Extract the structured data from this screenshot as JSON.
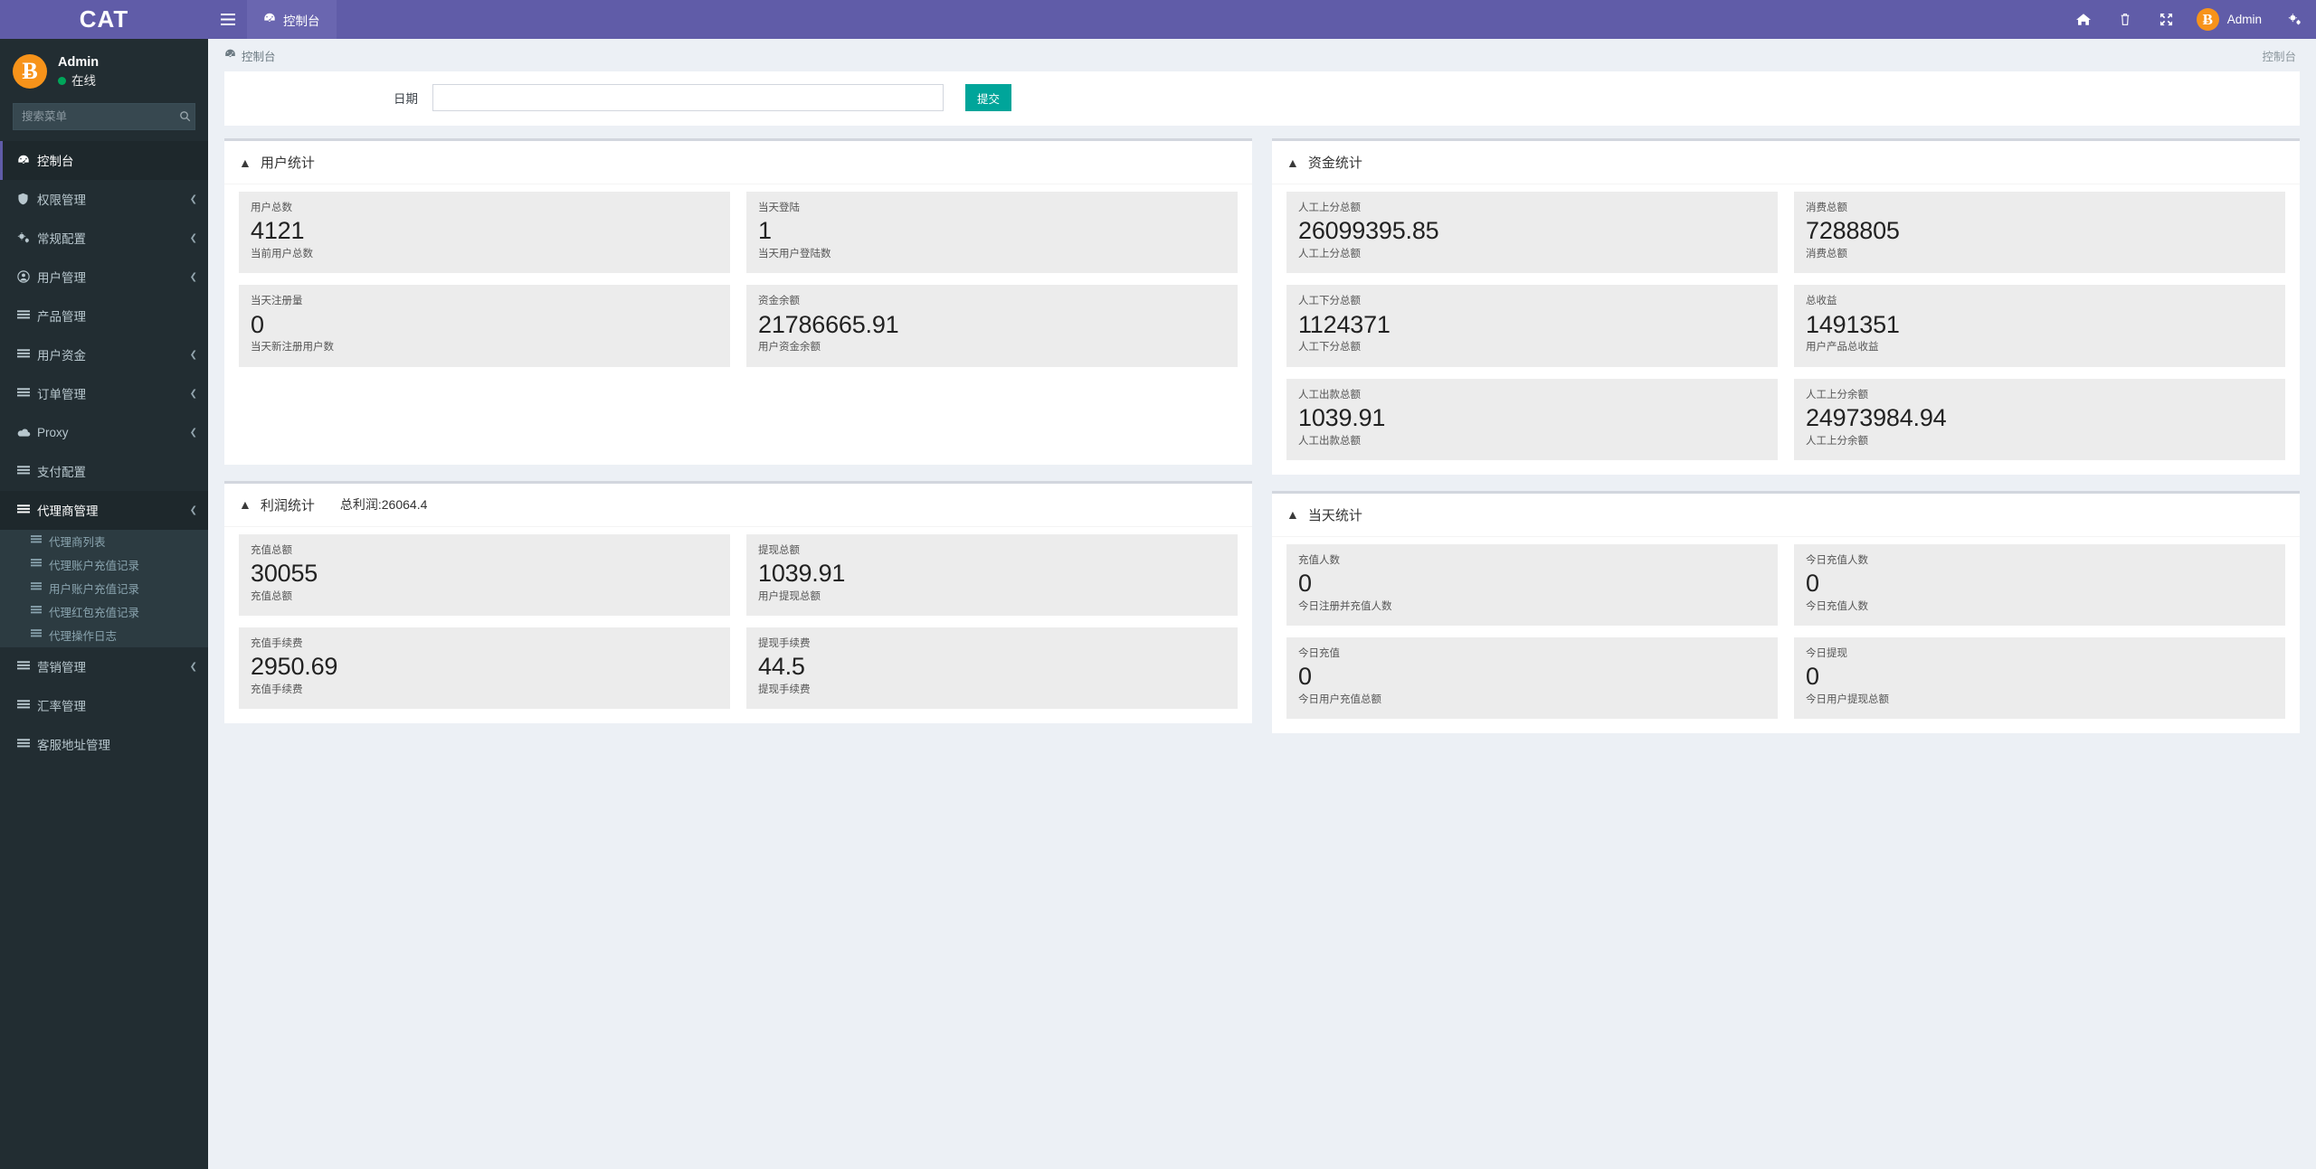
{
  "brand": {
    "title": "CAT"
  },
  "sidebar": {
    "user": {
      "name": "Admin",
      "status": "在线",
      "avatar_glyph": "Ƀ"
    },
    "search": {
      "placeholder": "搜索菜单",
      "value": ""
    },
    "items": [
      {
        "label": "控制台",
        "icon": "dashboard-icon",
        "active": true,
        "has_arrow": false
      },
      {
        "label": "权限管理",
        "icon": "shield-icon",
        "active": false,
        "has_arrow": true
      },
      {
        "label": "常规配置",
        "icon": "gears-icon",
        "active": false,
        "has_arrow": true
      },
      {
        "label": "用户管理",
        "icon": "user-circle-icon",
        "active": false,
        "has_arrow": true
      },
      {
        "label": "产品管理",
        "icon": "list-icon",
        "active": false,
        "has_arrow": false
      },
      {
        "label": "用户资金",
        "icon": "list-icon",
        "active": false,
        "has_arrow": true
      },
      {
        "label": "订单管理",
        "icon": "list-icon",
        "active": false,
        "has_arrow": true
      },
      {
        "label": "Proxy",
        "icon": "cloud-icon",
        "active": false,
        "has_arrow": true
      },
      {
        "label": "支付配置",
        "icon": "list-icon",
        "active": false,
        "has_arrow": false
      },
      {
        "label": "代理商管理",
        "icon": "list-icon",
        "active": false,
        "has_arrow": true,
        "submenu": [
          {
            "label": "代理商列表",
            "icon": "list-icon"
          },
          {
            "label": "代理账户充值记录",
            "icon": "list-icon"
          },
          {
            "label": "用户账户充值记录",
            "icon": "list-icon"
          },
          {
            "label": "代理红包充值记录",
            "icon": "list-icon"
          },
          {
            "label": "代理操作日志",
            "icon": "list-icon"
          }
        ]
      },
      {
        "label": "营销管理",
        "icon": "list-icon",
        "active": false,
        "has_arrow": true
      },
      {
        "label": "汇率管理",
        "icon": "list-icon",
        "active": false,
        "has_arrow": false
      },
      {
        "label": "客服地址管理",
        "icon": "list-icon",
        "active": false,
        "has_arrow": false
      }
    ]
  },
  "topbar": {
    "toggle_icon": "hamburger-icon",
    "tab_label": "控制台",
    "tab_icon": "dashboard-icon",
    "icons": [
      "home-icon",
      "trash-icon",
      "fullscreen-icon"
    ],
    "user_label": "Admin",
    "user_avatar_glyph": "Ƀ",
    "settings_icon": "gears-icon"
  },
  "content_header": {
    "breadcrumb": "控制台",
    "breadcrumb_icon": "dashboard-icon",
    "right_label": "控制台"
  },
  "filter": {
    "label": "日期",
    "value": "",
    "placeholder": "",
    "submit_label": "提交"
  },
  "panels": {
    "user_stats": {
      "title": "用户统计",
      "cards": [
        {
          "top": "用户总数",
          "value": "4121",
          "bottom": "当前用户总数"
        },
        {
          "top": "当天登陆",
          "value": "1",
          "bottom": "当天用户登陆数"
        },
        {
          "top": "当天注册量",
          "value": "0",
          "bottom": "当天新注册用户数"
        },
        {
          "top": "资金余额",
          "value": "21786665.91",
          "bottom": "用户资金余额"
        }
      ]
    },
    "fund_stats": {
      "title": "资金统计",
      "cards": [
        {
          "top": "人工上分总额",
          "value": "26099395.85",
          "bottom": "人工上分总额"
        },
        {
          "top": "消费总额",
          "value": "7288805",
          "bottom": "消费总额"
        },
        {
          "top": "人工下分总额",
          "value": "1124371",
          "bottom": "人工下分总额"
        },
        {
          "top": "总收益",
          "value": "1491351",
          "bottom": "用户产品总收益"
        },
        {
          "top": "人工出款总额",
          "value": "1039.91",
          "bottom": "人工出款总额"
        },
        {
          "top": "人工上分余额",
          "value": "24973984.94",
          "bottom": "人工上分余额"
        }
      ]
    },
    "profit_stats": {
      "title": "利润统计",
      "extra": "总利润:26064.4",
      "cards": [
        {
          "top": "充值总额",
          "value": "30055",
          "bottom": "充值总额"
        },
        {
          "top": "提现总额",
          "value": "1039.91",
          "bottom": "用户提现总额"
        },
        {
          "top": "充值手续费",
          "value": "2950.69",
          "bottom": "充值手续费"
        },
        {
          "top": "提现手续费",
          "value": "44.5",
          "bottom": "提现手续费"
        }
      ]
    },
    "today_stats": {
      "title": "当天统计",
      "cards": [
        {
          "top": "充值人数",
          "value": "0",
          "bottom": "今日注册并充值人数"
        },
        {
          "top": "今日充值人数",
          "value": "0",
          "bottom": "今日充值人数"
        },
        {
          "top": "今日充值",
          "value": "0",
          "bottom": "今日用户充值总额"
        },
        {
          "top": "今日提现",
          "value": "0",
          "bottom": "今日用户提现总额"
        }
      ]
    }
  },
  "colors": {
    "brand_purple": "#605ca8",
    "sidebar_dark": "#222d32",
    "submenu_dark": "#2c3b41",
    "accent_teal": "#00a59a",
    "bitcoin_orange": "#f7931a",
    "online_green": "#00a65a",
    "card_gray": "#ececec"
  }
}
